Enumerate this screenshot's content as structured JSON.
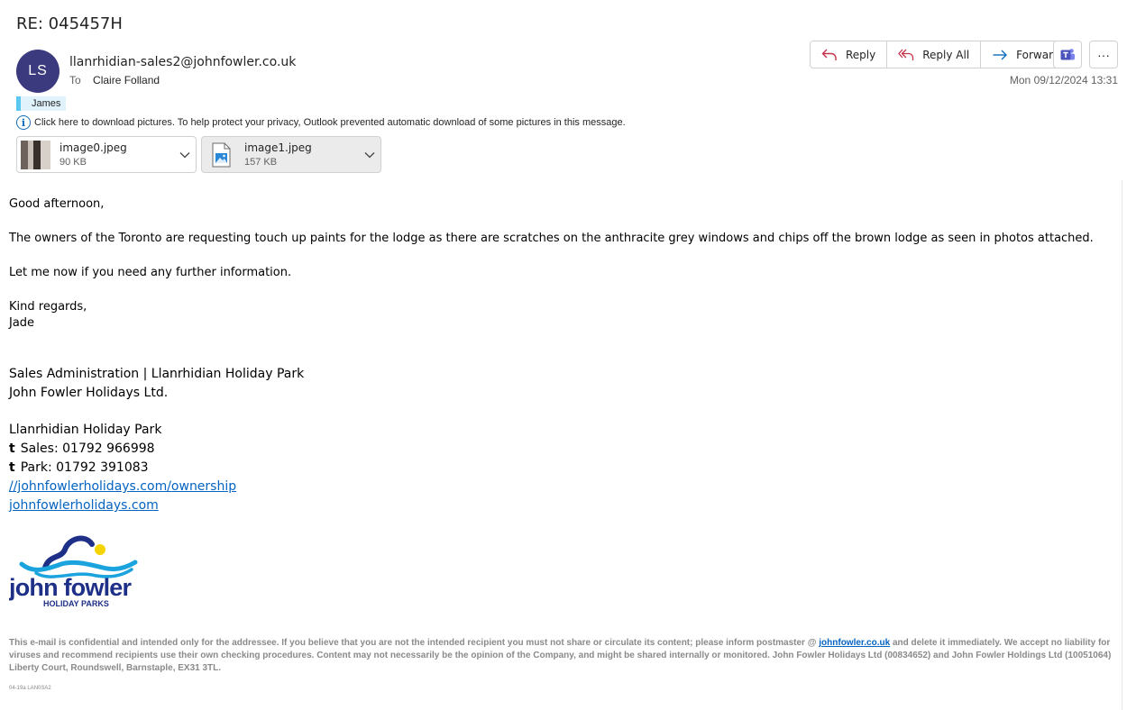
{
  "subject": "RE: 045457H",
  "sender": {
    "initials": "LS",
    "email": "llanrhidian-sales2@johnfowler.co.uk",
    "to_label": "To",
    "to_name": "Claire Folland",
    "avatar_color": "#3b3a7e"
  },
  "category_tag": "James",
  "privacy_notice": "Click here to download pictures. To help protect your privacy, Outlook prevented automatic download of some pictures in this message.",
  "attachments": [
    {
      "name": "image0.jpeg",
      "size": "90 KB"
    },
    {
      "name": "image1.jpeg",
      "size": "157 KB"
    }
  ],
  "toolbar": {
    "reply": "Reply",
    "reply_all": "Reply All",
    "forward": "Forward",
    "more": "···"
  },
  "date": "Mon 09/12/2024 13:31",
  "body": {
    "greeting": "Good afternoon,",
    "para1": "The owners of the Toronto are requesting touch up paints for the lodge as there are scratches on the anthracite grey windows and chips off the brown lodge as seen in photos attached.",
    "para2": "Let me now if you need any further information.",
    "closing": "Kind regards,",
    "name": "Jade"
  },
  "signature": {
    "role": "Sales Administration | Llanrhidian Holiday Park",
    "company": "John Fowler Holidays Ltd.",
    "park": "Llanrhidian Holiday Park",
    "t_label": "t",
    "sales": "Sales: 01792 966998",
    "park_phone": "Park:  01792 391083",
    "link1": "//johnfowlerholidays.com/ownership",
    "link2": "johnfowlerholidays.com",
    "logo_word": "john fowler",
    "logo_sub": "HOLIDAY PARKS"
  },
  "disclaimer": {
    "part1": "This e-mail is confidential and intended only for the addressee. If you believe that you are not the intended recipient  you must not share or circulate its content; please inform postmaster @ ",
    "link": "johnfowler.co.uk",
    "part2": " and delete it immediately. We accept no liability for viruses and recommend recipients use their own checking procedures. Content may not necessarily be the opinion of the Company, and might be shared internally or monitored. John Fowler Holidays Ltd (00834652) and John Fowler Holdings Ltd (10051064) Liberty Court, Roundswell, Barnstaple, EX31 3TL.",
    "code": "04-19a LAN0SA2"
  },
  "colors": {
    "accent_blue": "#0f6cbd",
    "tag_bar": "#5ac8f0",
    "logo_navy": "#1e2f87",
    "logo_cyan": "#1aa3dd",
    "logo_yellow": "#f5d400"
  }
}
